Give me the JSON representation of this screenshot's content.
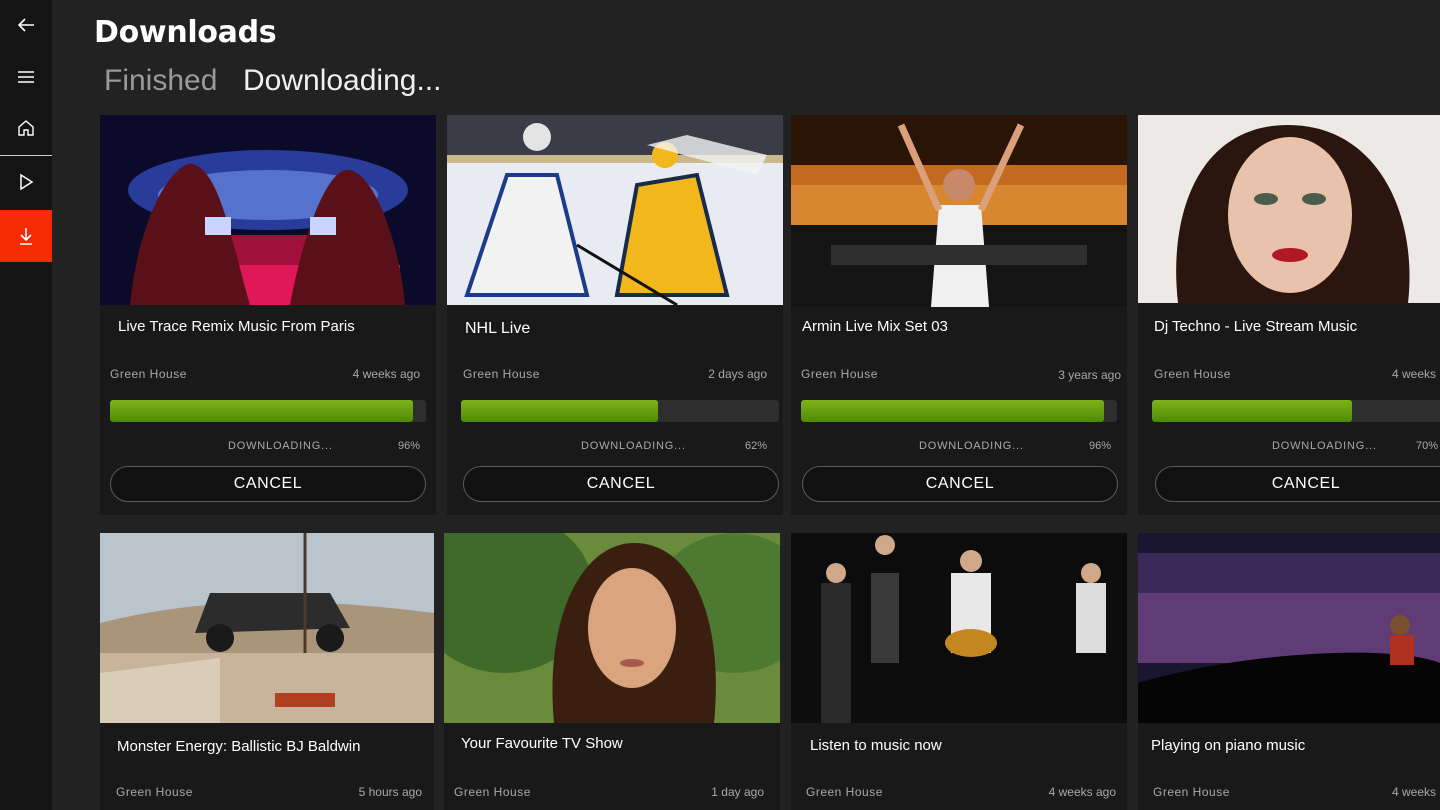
{
  "header": {
    "title": "Downloads",
    "tabs": [
      {
        "label": "Finished",
        "active": false
      },
      {
        "label": "Downloading...",
        "active": true
      }
    ]
  },
  "sidebar": {
    "items": [
      {
        "icon": "back-arrow-icon"
      },
      {
        "icon": "hamburger-menu-icon"
      },
      {
        "icon": "home-icon"
      },
      {
        "icon": "play-icon"
      },
      {
        "icon": "download-icon",
        "active": true
      }
    ],
    "accent": "#f52a00"
  },
  "downloading": [
    {
      "title": "Live Trace Remix Music From Paris",
      "channel": "Green House",
      "time": "4 weeks ago",
      "status": "DOWNLOADING...",
      "progress": "96%",
      "cancel": "CANCEL"
    },
    {
      "title": "NHL Live",
      "channel": "Green House",
      "time": "2 days ago",
      "status": "DOWNLOADING...",
      "progress": "62%",
      "cancel": "CANCEL"
    },
    {
      "title": "Armin Live Mix Set 03",
      "channel": "Green House",
      "time": "3 years ago",
      "status": "DOWNLOADING...",
      "progress": "96%",
      "cancel": "CANCEL"
    },
    {
      "title": "Dj Techno - Live Stream Music",
      "channel": "Green House",
      "time": "4 weeks",
      "status": "DOWNLOADING...",
      "progress": "70%",
      "cancel": "CANCEL"
    }
  ],
  "queued": [
    {
      "title": "Monster Energy: Ballistic BJ Baldwin",
      "channel": "Green House",
      "time": "5 hours ago"
    },
    {
      "title": "Your Favourite TV Show",
      "channel": "Green House",
      "time": "1 day ago"
    },
    {
      "title": "Listen to music now",
      "channel": "Green House",
      "time": "4 weeks ago"
    },
    {
      "title": "Playing on piano music",
      "channel": "Green House",
      "time": "4 weeks"
    }
  ],
  "colors": {
    "progress": "#6ba514",
    "background": "#222222",
    "card": "#191919"
  }
}
